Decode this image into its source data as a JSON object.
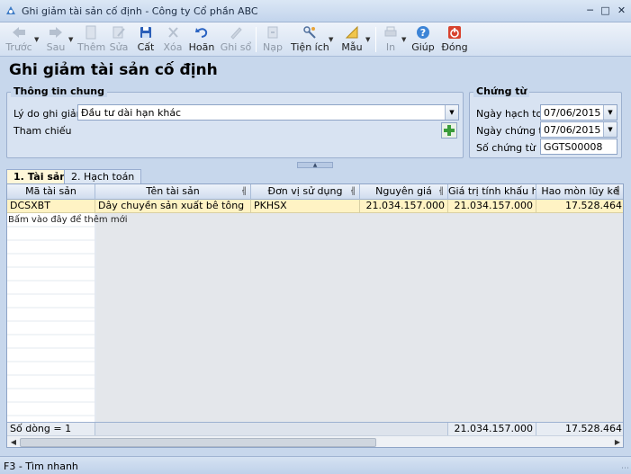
{
  "window": {
    "title": "Ghi giảm tài sản cố định - Công ty Cổ phần ABC",
    "minimize_icon": "minimize-icon",
    "maximize_icon": "maximize-icon",
    "close_icon": "close-icon"
  },
  "toolbar": {
    "back": "Trước",
    "next": "Sau",
    "add": "Thêm",
    "edit": "Sửa",
    "save": "Cất",
    "delete": "Xóa",
    "undo": "Hoãn",
    "post": "Ghi sổ",
    "load": "Nạp",
    "utilities": "Tiện ích",
    "template": "Mẫu",
    "print": "In",
    "help": "Giúp",
    "close": "Đóng"
  },
  "form": {
    "title": "Ghi giảm tài sản cố định",
    "general": {
      "title": "Thông tin chung",
      "reason_label": "Lý do ghi giảm",
      "reason_value": "Đầu tư dài hạn khác",
      "reference_label": "Tham chiếu"
    },
    "voucher": {
      "title": "Chứng từ",
      "posting_date_label": "Ngày hạch toán",
      "posting_date": "07/06/2015",
      "voucher_date_label": "Ngày chứng từ",
      "voucher_date": "07/06/2015",
      "voucher_no_label": "Số chứng từ",
      "voucher_no": "GGTS00008"
    }
  },
  "tabs": [
    {
      "key": "1.",
      "label": "Tài sản",
      "active": true
    },
    {
      "key": "2.",
      "label": "Hạch toán",
      "active": false
    }
  ],
  "grid": {
    "columns": [
      "Mã tài sản",
      "Tên tài sản",
      "Đơn vị sử dụng",
      "Nguyên giá",
      "Giá trị tính khấu hao",
      "Hao mòn lũy kế"
    ],
    "rows": [
      {
        "code": "DCSXBT",
        "name": "Dây chuyền sản xuất bê tông",
        "unit": "PKHSX",
        "cost": "21.034.157.000",
        "depreciable": "21.034.157.000",
        "accumulated": "17.528.464"
      }
    ],
    "add_row_hint": "Bấm vào đây để thêm mới",
    "footer": {
      "row_count": "Số dòng = 1",
      "total_depreciable": "21.034.157.000",
      "total_accumulated": "17.528.464"
    }
  },
  "status": {
    "quick_search": "F3 - Tìm nhanh"
  }
}
